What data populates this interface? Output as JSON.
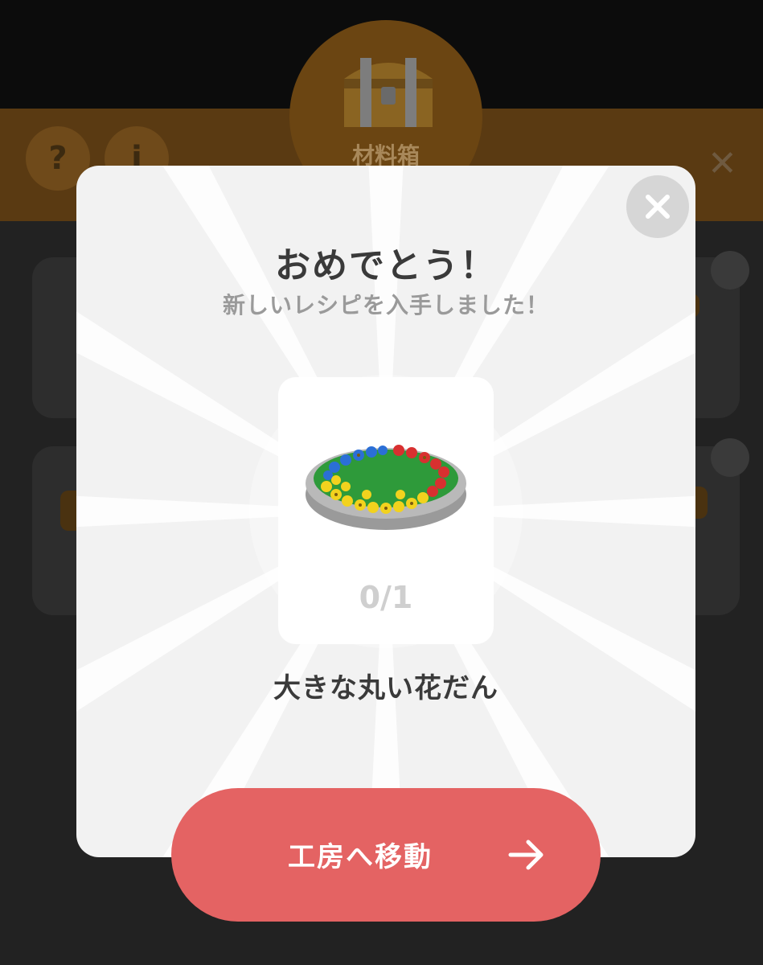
{
  "background": {
    "panel_title": "材料箱",
    "help_label": "?",
    "info_label": "i",
    "close_label": "✕"
  },
  "modal": {
    "title": "おめでとう！",
    "subtitle": "新しいレシピを入手しました！",
    "close_icon": "close-icon",
    "item": {
      "count": "0/1",
      "name": "大きな丸い花だん"
    },
    "action_button": {
      "label": "工房へ移動",
      "icon": "arrow-right-icon"
    }
  },
  "colors": {
    "modal_bg": "#f2f2f2",
    "button": "#e46363",
    "title_text": "#3a3a3a",
    "subtitle_text": "#9a9a9a"
  }
}
